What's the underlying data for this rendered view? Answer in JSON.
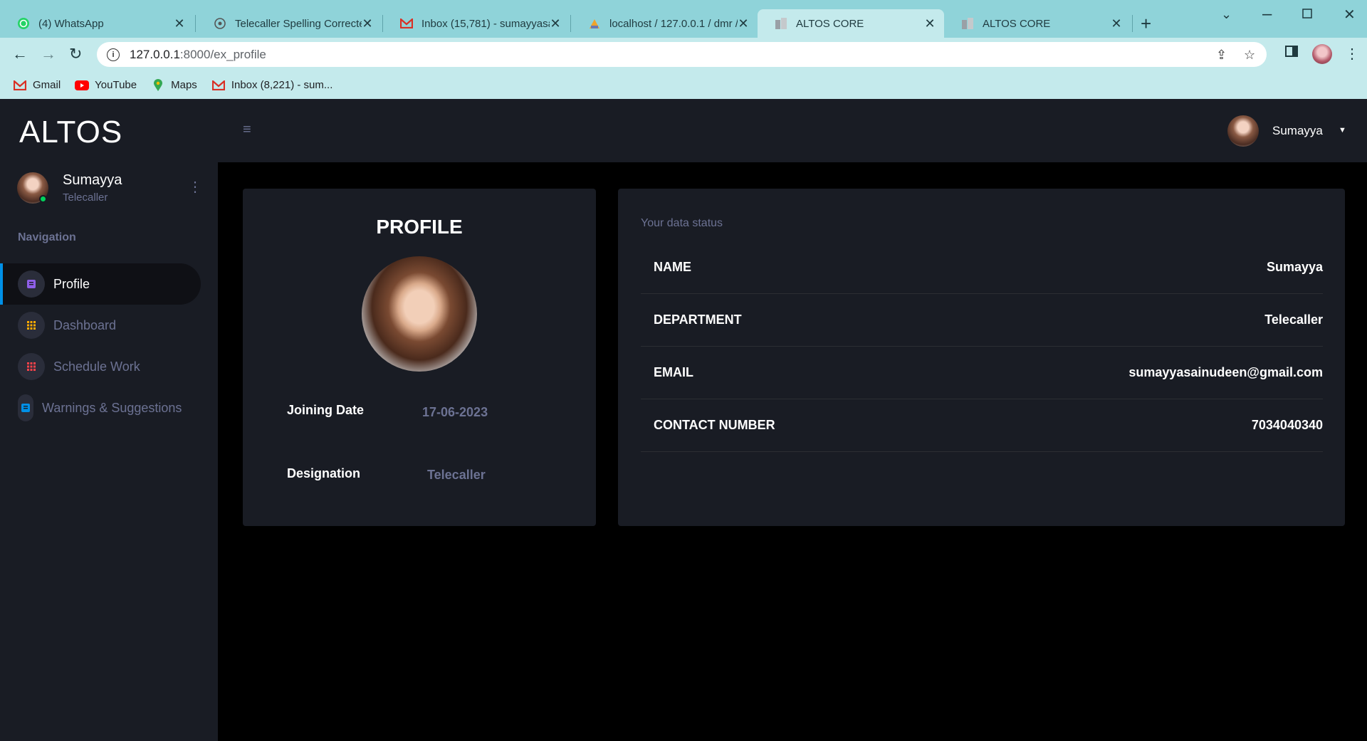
{
  "browser": {
    "tabs": [
      {
        "title": "(4) WhatsApp",
        "icon": "whatsapp-icon"
      },
      {
        "title": "Telecaller Spelling Correctec",
        "icon": "openai-icon"
      },
      {
        "title": "Inbox (15,781) - sumayyasai",
        "icon": "gmail-icon"
      },
      {
        "title": "localhost / 127.0.0.1 / dmr /",
        "icon": "phpmyadmin-icon"
      },
      {
        "title": "ALTOS CORE",
        "icon": "page-icon"
      },
      {
        "title": "ALTOS CORE",
        "icon": "page-icon"
      }
    ],
    "url_host": "127.0.0.1",
    "url_path": ":8000/ex_profile",
    "bookmarks": [
      {
        "label": "Gmail",
        "icon": "gmail-icon"
      },
      {
        "label": "YouTube",
        "icon": "youtube-icon"
      },
      {
        "label": "Maps",
        "icon": "maps-icon"
      },
      {
        "label": "Inbox (8,221) - sum...",
        "icon": "gmail-icon"
      }
    ]
  },
  "app": {
    "brand": "ALTOS",
    "user": {
      "name": "Sumayya",
      "role": "Telecaller"
    },
    "nav_heading": "Navigation",
    "nav": [
      {
        "label": "Profile",
        "icon": "profile-icon",
        "color": "#8f5fe8"
      },
      {
        "label": "Dashboard",
        "icon": "grid-icon",
        "color": "#ffab00"
      },
      {
        "label": "Schedule Work",
        "icon": "grid-icon",
        "color": "#fc424a"
      },
      {
        "label": "Warnings & Suggestions",
        "icon": "document-icon",
        "color": "#0090e7"
      }
    ],
    "topbar": {
      "user_name": "Sumayya"
    },
    "profile": {
      "title": "PROFILE",
      "joining_label": "Joining Date",
      "joining_value": "17-06-2023",
      "designation_label": "Designation",
      "designation_value": "Telecaller"
    },
    "status": {
      "caption": "Your data status",
      "rows": [
        {
          "key": "NAME",
          "value": "Sumayya"
        },
        {
          "key": "DEPARTMENT",
          "value": "Telecaller"
        },
        {
          "key": "EMAIL",
          "value": "sumayyasainudeen@gmail.com"
        },
        {
          "key": "CONTACT NUMBER",
          "value": "7034040340"
        }
      ]
    }
  }
}
